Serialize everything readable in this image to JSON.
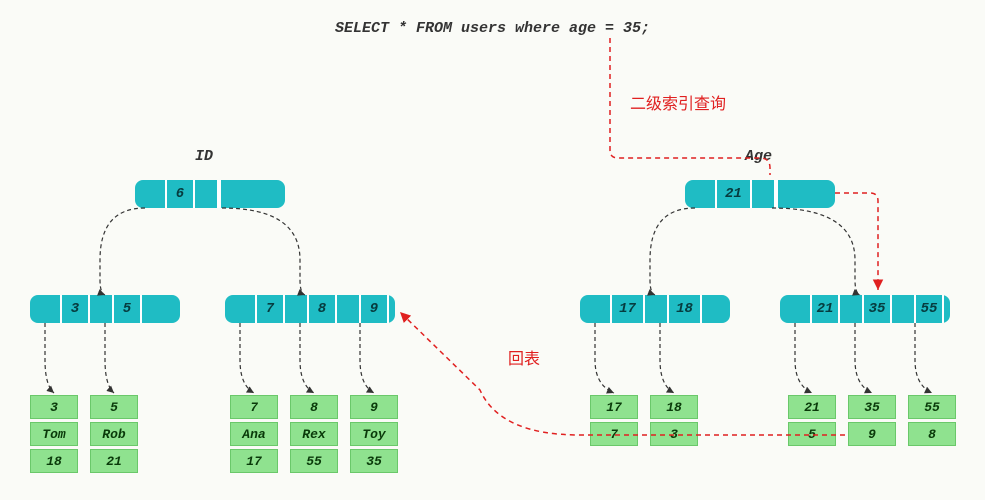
{
  "query": "SELECT * FROM users where age = 35;",
  "annotations": {
    "secondary_index_lookup": "二级索引查询",
    "back_to_table": "回表"
  },
  "trees": {
    "id": {
      "label": "ID",
      "root": {
        "keys": [
          "6"
        ]
      },
      "level2": [
        {
          "keys": [
            "3",
            "5"
          ]
        },
        {
          "keys": [
            "7",
            "8",
            "9"
          ]
        }
      ],
      "leaves": [
        {
          "id": "3",
          "name": "Tom",
          "age": "18"
        },
        {
          "id": "5",
          "name": "Rob",
          "age": "21"
        },
        {
          "id": "7",
          "name": "Ana",
          "age": "17"
        },
        {
          "id": "8",
          "name": "Rex",
          "age": "55"
        },
        {
          "id": "9",
          "name": "Toy",
          "age": "35"
        }
      ]
    },
    "age": {
      "label": "Age",
      "root": {
        "keys": [
          "21"
        ]
      },
      "level2": [
        {
          "keys": [
            "17",
            "18"
          ]
        },
        {
          "keys": [
            "21",
            "35",
            "55"
          ]
        }
      ],
      "leaves": [
        {
          "age": "17",
          "id": "7"
        },
        {
          "age": "18",
          "id": "3"
        },
        {
          "age": "21",
          "id": "5"
        },
        {
          "age": "35",
          "id": "9"
        },
        {
          "age": "55",
          "id": "8"
        }
      ]
    }
  },
  "chart_data": {
    "type": "diagram",
    "description": "B+Tree secondary index lookup diagram: query on age=35 traverses Age secondary index tree, finds primary key id=9, then performs 回表 (back-to-table) lookup on ID primary index tree to retrieve full row (9, Toy, 35).",
    "primary_index": {
      "column": "ID",
      "root": [
        6
      ],
      "internal": [
        [
          3,
          5
        ],
        [
          7,
          8,
          9
        ]
      ],
      "rows": [
        {
          "id": 3,
          "name": "Tom",
          "age": 18
        },
        {
          "id": 5,
          "name": "Rob",
          "age": 21
        },
        {
          "id": 7,
          "name": "Ana",
          "age": 17
        },
        {
          "id": 8,
          "name": "Rex",
          "age": 55
        },
        {
          "id": 9,
          "name": "Toy",
          "age": 35
        }
      ]
    },
    "secondary_index": {
      "column": "Age",
      "root": [
        21
      ],
      "internal": [
        [
          17,
          18
        ],
        [
          21,
          35,
          55
        ]
      ],
      "entries": [
        {
          "age": 17,
          "id": 7
        },
        {
          "age": 18,
          "id": 3
        },
        {
          "age": 21,
          "id": 5
        },
        {
          "age": 35,
          "id": 9
        },
        {
          "age": 55,
          "id": 8
        }
      ]
    },
    "lookup_path": {
      "age_value": 35,
      "secondary_path": [
        21,
        35
      ],
      "found_id": 9,
      "primary_path": [
        6,
        9
      ],
      "result_row": {
        "id": 9,
        "name": "Toy",
        "age": 35
      }
    }
  }
}
